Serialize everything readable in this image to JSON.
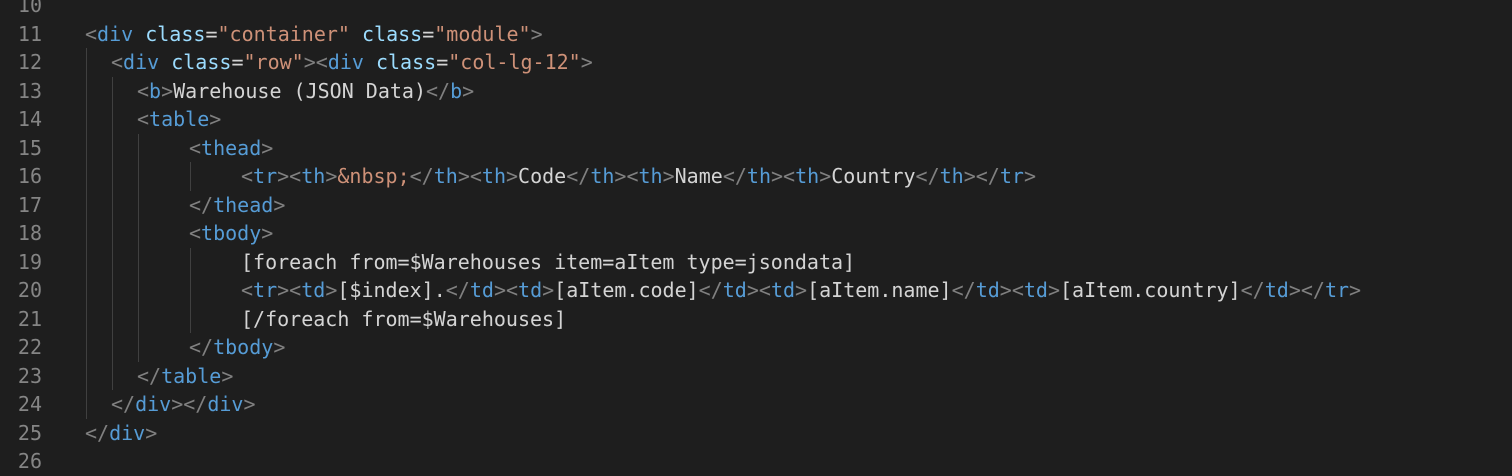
{
  "editor": {
    "lines": [
      {
        "num": "10",
        "guides": [],
        "tokens": []
      },
      {
        "num": "11",
        "guides": [],
        "tokens": [
          {
            "t": "<",
            "c": "punc"
          },
          {
            "t": "div",
            "c": "tag"
          },
          {
            "t": " ",
            "c": "txt"
          },
          {
            "t": "class",
            "c": "attr"
          },
          {
            "t": "=",
            "c": "eq"
          },
          {
            "t": "\"container\"",
            "c": "str"
          },
          {
            "t": " ",
            "c": "txt"
          },
          {
            "t": "class",
            "c": "attr"
          },
          {
            "t": "=",
            "c": "eq"
          },
          {
            "t": "\"module\"",
            "c": "str"
          },
          {
            "t": ">",
            "c": "punc"
          }
        ]
      },
      {
        "num": "12",
        "indent": 1,
        "guides": [
          0
        ],
        "tokens": [
          {
            "t": "<",
            "c": "punc"
          },
          {
            "t": "div",
            "c": "tag"
          },
          {
            "t": " ",
            "c": "txt"
          },
          {
            "t": "class",
            "c": "attr"
          },
          {
            "t": "=",
            "c": "eq"
          },
          {
            "t": "\"row\"",
            "c": "str"
          },
          {
            "t": "><",
            "c": "punc"
          },
          {
            "t": "div",
            "c": "tag"
          },
          {
            "t": " ",
            "c": "txt"
          },
          {
            "t": "class",
            "c": "attr"
          },
          {
            "t": "=",
            "c": "eq"
          },
          {
            "t": "\"col-lg-12\"",
            "c": "str"
          },
          {
            "t": ">",
            "c": "punc"
          }
        ]
      },
      {
        "num": "13",
        "indent": 2,
        "guides": [
          0,
          1
        ],
        "tokens": [
          {
            "t": "<",
            "c": "punc"
          },
          {
            "t": "b",
            "c": "tag"
          },
          {
            "t": ">",
            "c": "punc"
          },
          {
            "t": "Warehouse (JSON Data)",
            "c": "txt"
          },
          {
            "t": "</",
            "c": "punc"
          },
          {
            "t": "b",
            "c": "tag"
          },
          {
            "t": ">",
            "c": "punc"
          }
        ]
      },
      {
        "num": "14",
        "indent": 2,
        "guides": [
          0,
          1
        ],
        "tokens": [
          {
            "t": "<",
            "c": "punc"
          },
          {
            "t": "table",
            "c": "tag"
          },
          {
            "t": ">",
            "c": "punc"
          }
        ]
      },
      {
        "num": "15",
        "indent": 4,
        "guides": [
          0,
          1,
          2
        ],
        "tokens": [
          {
            "t": "<",
            "c": "punc"
          },
          {
            "t": "thead",
            "c": "tag"
          },
          {
            "t": ">",
            "c": "punc"
          }
        ]
      },
      {
        "num": "16",
        "indent": 6,
        "guides": [
          0,
          1,
          2,
          4
        ],
        "tokens": [
          {
            "t": "<",
            "c": "punc"
          },
          {
            "t": "tr",
            "c": "tag"
          },
          {
            "t": "><",
            "c": "punc"
          },
          {
            "t": "th",
            "c": "tag"
          },
          {
            "t": ">",
            "c": "punc"
          },
          {
            "t": "&nbsp;",
            "c": "str"
          },
          {
            "t": "</",
            "c": "punc"
          },
          {
            "t": "th",
            "c": "tag"
          },
          {
            "t": "><",
            "c": "punc"
          },
          {
            "t": "th",
            "c": "tag"
          },
          {
            "t": ">",
            "c": "punc"
          },
          {
            "t": "Code",
            "c": "txt"
          },
          {
            "t": "</",
            "c": "punc"
          },
          {
            "t": "th",
            "c": "tag"
          },
          {
            "t": "><",
            "c": "punc"
          },
          {
            "t": "th",
            "c": "tag"
          },
          {
            "t": ">",
            "c": "punc"
          },
          {
            "t": "Name",
            "c": "txt"
          },
          {
            "t": "</",
            "c": "punc"
          },
          {
            "t": "th",
            "c": "tag"
          },
          {
            "t": "><",
            "c": "punc"
          },
          {
            "t": "th",
            "c": "tag"
          },
          {
            "t": ">",
            "c": "punc"
          },
          {
            "t": "Country",
            "c": "txt"
          },
          {
            "t": "</",
            "c": "punc"
          },
          {
            "t": "th",
            "c": "tag"
          },
          {
            "t": "></",
            "c": "punc"
          },
          {
            "t": "tr",
            "c": "tag"
          },
          {
            "t": ">",
            "c": "punc"
          }
        ]
      },
      {
        "num": "17",
        "indent": 4,
        "guides": [
          0,
          1,
          2
        ],
        "tokens": [
          {
            "t": "</",
            "c": "punc"
          },
          {
            "t": "thead",
            "c": "tag"
          },
          {
            "t": ">",
            "c": "punc"
          }
        ]
      },
      {
        "num": "18",
        "indent": 4,
        "guides": [
          0,
          1,
          2
        ],
        "tokens": [
          {
            "t": "<",
            "c": "punc"
          },
          {
            "t": "tbody",
            "c": "tag"
          },
          {
            "t": ">",
            "c": "punc"
          }
        ]
      },
      {
        "num": "19",
        "indent": 6,
        "guides": [
          0,
          1,
          2,
          4
        ],
        "tokens": [
          {
            "t": "[foreach from=$Warehouses item=aItem type=jsondata]",
            "c": "txt"
          }
        ]
      },
      {
        "num": "20",
        "indent": 6,
        "guides": [
          0,
          1,
          2,
          4
        ],
        "tokens": [
          {
            "t": "<",
            "c": "punc"
          },
          {
            "t": "tr",
            "c": "tag"
          },
          {
            "t": "><",
            "c": "punc"
          },
          {
            "t": "td",
            "c": "tag"
          },
          {
            "t": ">",
            "c": "punc"
          },
          {
            "t": "[$index].",
            "c": "txt"
          },
          {
            "t": "</",
            "c": "punc"
          },
          {
            "t": "td",
            "c": "tag"
          },
          {
            "t": "><",
            "c": "punc"
          },
          {
            "t": "td",
            "c": "tag"
          },
          {
            "t": ">",
            "c": "punc"
          },
          {
            "t": "[aItem.code]",
            "c": "txt"
          },
          {
            "t": "</",
            "c": "punc"
          },
          {
            "t": "td",
            "c": "tag"
          },
          {
            "t": "><",
            "c": "punc"
          },
          {
            "t": "td",
            "c": "tag"
          },
          {
            "t": ">",
            "c": "punc"
          },
          {
            "t": "[aItem.name]",
            "c": "txt"
          },
          {
            "t": "</",
            "c": "punc"
          },
          {
            "t": "td",
            "c": "tag"
          },
          {
            "t": "><",
            "c": "punc"
          },
          {
            "t": "td",
            "c": "tag"
          },
          {
            "t": ">",
            "c": "punc"
          },
          {
            "t": "[aItem.country]",
            "c": "txt"
          },
          {
            "t": "</",
            "c": "punc"
          },
          {
            "t": "td",
            "c": "tag"
          },
          {
            "t": "></",
            "c": "punc"
          },
          {
            "t": "tr",
            "c": "tag"
          },
          {
            "t": ">",
            "c": "punc"
          }
        ]
      },
      {
        "num": "21",
        "indent": 6,
        "guides": [
          0,
          1,
          2,
          4
        ],
        "tokens": [
          {
            "t": "[/foreach from=$Warehouses]",
            "c": "txt"
          }
        ]
      },
      {
        "num": "22",
        "indent": 4,
        "guides": [
          0,
          1,
          2
        ],
        "tokens": [
          {
            "t": "</",
            "c": "punc"
          },
          {
            "t": "tbody",
            "c": "tag"
          },
          {
            "t": ">",
            "c": "punc"
          }
        ]
      },
      {
        "num": "23",
        "indent": 2,
        "guides": [
          0,
          1
        ],
        "tokens": [
          {
            "t": "</",
            "c": "punc"
          },
          {
            "t": "table",
            "c": "tag"
          },
          {
            "t": ">",
            "c": "punc"
          }
        ]
      },
      {
        "num": "24",
        "indent": 1,
        "guides": [
          0
        ],
        "tokens": [
          {
            "t": "</",
            "c": "punc"
          },
          {
            "t": "div",
            "c": "tag"
          },
          {
            "t": "></",
            "c": "punc"
          },
          {
            "t": "div",
            "c": "tag"
          },
          {
            "t": ">",
            "c": "punc"
          }
        ]
      },
      {
        "num": "25",
        "guides": [],
        "tokens": [
          {
            "t": "</",
            "c": "punc"
          },
          {
            "t": "div",
            "c": "tag"
          },
          {
            "t": ">",
            "c": "punc"
          }
        ]
      },
      {
        "num": "26",
        "guides": [],
        "tokens": []
      }
    ]
  }
}
